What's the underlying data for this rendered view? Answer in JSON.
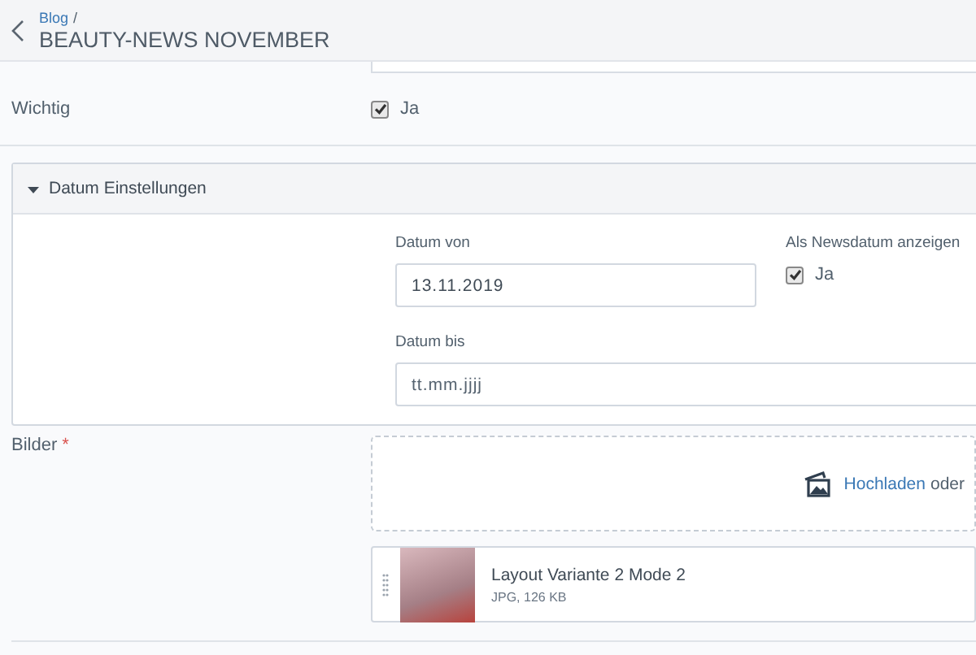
{
  "header": {
    "breadcrumb": "Blog",
    "separator": "/",
    "title": "BEAUTY-NEWS NOVEMBER"
  },
  "wichtig": {
    "label": "Wichtig",
    "checkbox_label": "Ja",
    "checked": true
  },
  "date_panel": {
    "title": "Datum Einstellungen",
    "expanded": true,
    "date_from": {
      "label": "Datum von",
      "value": "13.11.2019"
    },
    "show_as_news_date": {
      "label": "Als Newsdatum anzeigen",
      "checkbox_label": "Ja",
      "checked": true
    },
    "date_to": {
      "label": "Datum bis",
      "placeholder": "tt.mm.jjjj"
    }
  },
  "images": {
    "label": "Bilder",
    "required_marker": "*",
    "upload_link": "Hochladen",
    "upload_text": "oder",
    "files": [
      {
        "name": "Layout Variante 2 Mode 2",
        "meta": "JPG, 126 KB"
      }
    ]
  }
}
